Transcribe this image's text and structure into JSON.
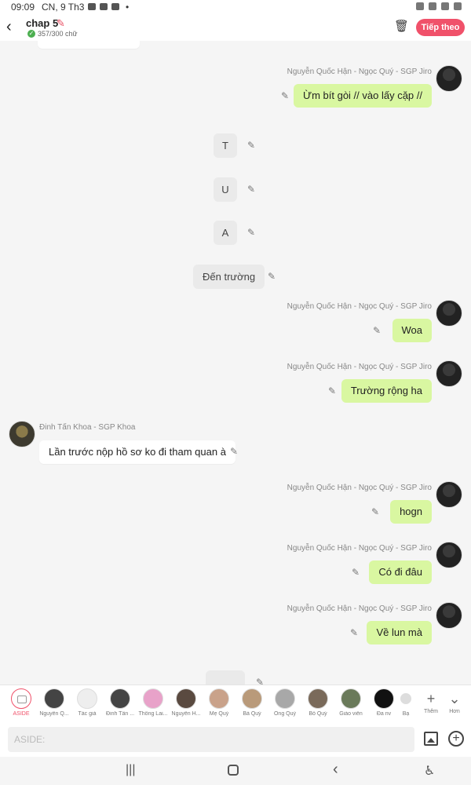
{
  "statusbar": {
    "time": "09:09",
    "date": "CN, 9 Th3",
    "dot": "•"
  },
  "header": {
    "back_glyph": "‹",
    "title": "chap 5",
    "word_count": "357/300 chữ",
    "next_label": "Tiếp theo"
  },
  "messages": [
    {
      "type": "me",
      "sender": "Nguyễn Quốc Hận - Ngọc Quý - SGP Jiro",
      "text": "Ừm bít gòi // vào lấy cặp //"
    },
    {
      "type": "narr",
      "text": "T"
    },
    {
      "type": "narr",
      "text": "U"
    },
    {
      "type": "narr",
      "text": "A"
    },
    {
      "type": "narr",
      "text": "Đến trường"
    },
    {
      "type": "me",
      "sender": "Nguyễn Quốc Hận - Ngọc Quý - SGP Jiro",
      "text": "Woa"
    },
    {
      "type": "me",
      "sender": "Nguyễn Quốc Hận - Ngọc Quý - SGP Jiro",
      "text": "Trường rộng ha"
    },
    {
      "type": "other",
      "sender": "Đinh Tấn Khoa - SGP Khoa",
      "text": "Lần trước nộp hồ sơ ko đi tham quan à"
    },
    {
      "type": "me",
      "sender": "Nguyễn Quốc Hận - Ngọc Quý - SGP Jiro",
      "text": "hogn"
    },
    {
      "type": "me",
      "sender": "Nguyễn Quốc Hận - Ngọc Quý - SGP Jiro",
      "text": "Có đi đâu"
    },
    {
      "type": "me",
      "sender": "Nguyễn Quốc Hận - Ngọc Quý - SGP Jiro",
      "text": "Về lun mà"
    }
  ],
  "characters": [
    {
      "label": "ASIDE"
    },
    {
      "label": "Nguyễn Q..."
    },
    {
      "label": "Tác giả"
    },
    {
      "label": "Đinh Tấn ..."
    },
    {
      "label": "Thông Lai..."
    },
    {
      "label": "Nguyễn H..."
    },
    {
      "label": "Mẹ Quý"
    },
    {
      "label": "Bà Quý"
    },
    {
      "label": "Ông Quý"
    },
    {
      "label": "Bố Quý"
    },
    {
      "label": "Giáo viên"
    },
    {
      "label": "Đa nv"
    },
    {
      "label": "Bạ"
    }
  ],
  "tools": {
    "add_label": "Thêm",
    "more_label": "Hơn"
  },
  "input": {
    "placeholder": "ASIDE:"
  },
  "colors": {
    "accent": "#f0516a",
    "me_bubble": "#d9f7a1",
    "background": "#f5f5f5"
  }
}
